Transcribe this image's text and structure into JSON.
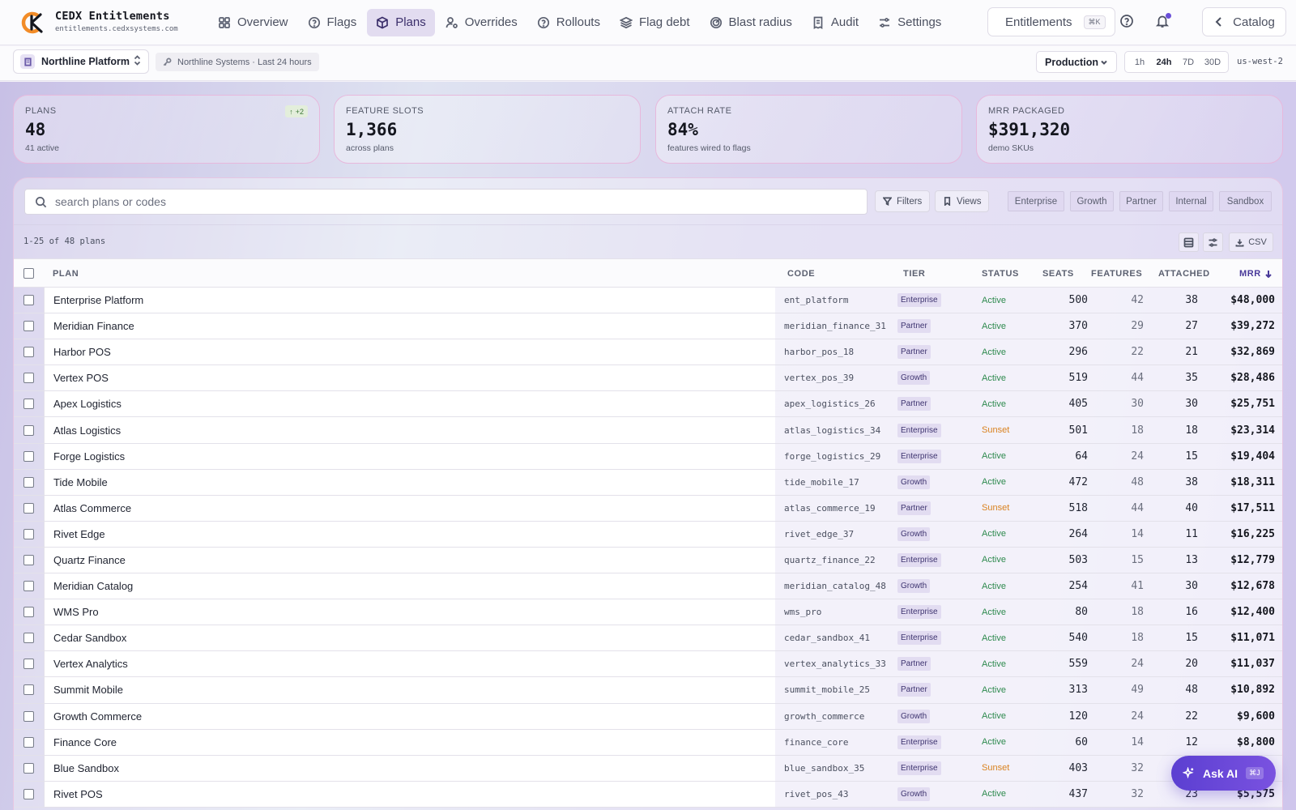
{
  "app": {
    "name": "CEDX Entitlements",
    "domain": "entitlements.cedxsystems.com"
  },
  "nav": {
    "tabs": [
      {
        "label": "Overview",
        "icon": "grid-icon"
      },
      {
        "label": "Flags",
        "icon": "help-circle-icon"
      },
      {
        "label": "Plans",
        "icon": "package-icon",
        "active": true
      },
      {
        "label": "Overrides",
        "icon": "user-cog-icon"
      },
      {
        "label": "Rollouts",
        "icon": "help-circle-icon"
      },
      {
        "label": "Flag debt",
        "icon": "layers-icon"
      },
      {
        "label": "Blast radius",
        "icon": "radar-icon"
      },
      {
        "label": "Audit",
        "icon": "receipt-icon"
      },
      {
        "label": "Settings",
        "icon": "sliders-icon"
      }
    ],
    "search_label": "Entitlements",
    "search_shortcut": "⌘K",
    "catalog_label": "Catalog"
  },
  "subbar": {
    "workspace": "Northline Platform",
    "context": "Northline Systems · Last 24 hours",
    "environment": "Production",
    "ranges": [
      "1h",
      "24h",
      "7D",
      "30D"
    ],
    "active_range": "24h",
    "region": "us-west-2"
  },
  "kpis": [
    {
      "label": "Plans",
      "value": "48",
      "sub": "41 active",
      "delta": "+2"
    },
    {
      "label": "Feature slots",
      "value": "1,366",
      "sub": "across plans"
    },
    {
      "label": "Attach rate",
      "value": "84%",
      "sub": "features wired to flags"
    },
    {
      "label": "MRR packaged",
      "value": "$391,320",
      "sub": "demo SKUs"
    }
  ],
  "toolbar": {
    "search_placeholder": "search plans or codes",
    "filters_label": "Filters",
    "views_label": "Views",
    "tier_chips": [
      "Enterprise",
      "Growth",
      "Partner",
      "Internal",
      "Sandbox"
    ],
    "count_text": "1-25 of 48 plans",
    "csv_label": "CSV"
  },
  "table": {
    "headers": {
      "plan": "Plan",
      "code": "Code",
      "tier": "Tier",
      "status": "Status",
      "seats": "Seats",
      "features": "Features",
      "attached": "Attached",
      "mrr": "MRR"
    },
    "rows": [
      {
        "plan": "Enterprise Platform",
        "code": "ent_platform",
        "tier": "Enterprise",
        "status": "Active",
        "seats": "500",
        "features": "42",
        "attached": "38",
        "mrr": "$48,000"
      },
      {
        "plan": "Meridian Finance",
        "code": "meridian_finance_31",
        "tier": "Partner",
        "status": "Active",
        "seats": "370",
        "features": "29",
        "attached": "27",
        "mrr": "$39,272"
      },
      {
        "plan": "Harbor POS",
        "code": "harbor_pos_18",
        "tier": "Partner",
        "status": "Active",
        "seats": "296",
        "features": "22",
        "attached": "21",
        "mrr": "$32,869"
      },
      {
        "plan": "Vertex POS",
        "code": "vertex_pos_39",
        "tier": "Growth",
        "status": "Active",
        "seats": "519",
        "features": "44",
        "attached": "35",
        "mrr": "$28,486"
      },
      {
        "plan": "Apex Logistics",
        "code": "apex_logistics_26",
        "tier": "Partner",
        "status": "Active",
        "seats": "405",
        "features": "30",
        "attached": "30",
        "mrr": "$25,751"
      },
      {
        "plan": "Atlas Logistics",
        "code": "atlas_logistics_34",
        "tier": "Enterprise",
        "status": "Sunset",
        "seats": "501",
        "features": "18",
        "attached": "18",
        "mrr": "$23,314"
      },
      {
        "plan": "Forge Logistics",
        "code": "forge_logistics_29",
        "tier": "Enterprise",
        "status": "Active",
        "seats": "64",
        "features": "24",
        "attached": "15",
        "mrr": "$19,404"
      },
      {
        "plan": "Tide Mobile",
        "code": "tide_mobile_17",
        "tier": "Growth",
        "status": "Active",
        "seats": "472",
        "features": "48",
        "attached": "38",
        "mrr": "$18,311"
      },
      {
        "plan": "Atlas Commerce",
        "code": "atlas_commerce_19",
        "tier": "Partner",
        "status": "Sunset",
        "seats": "518",
        "features": "44",
        "attached": "40",
        "mrr": "$17,511"
      },
      {
        "plan": "Rivet Edge",
        "code": "rivet_edge_37",
        "tier": "Growth",
        "status": "Active",
        "seats": "264",
        "features": "14",
        "attached": "11",
        "mrr": "$16,225"
      },
      {
        "plan": "Quartz Finance",
        "code": "quartz_finance_22",
        "tier": "Enterprise",
        "status": "Active",
        "seats": "503",
        "features": "15",
        "attached": "13",
        "mrr": "$12,779"
      },
      {
        "plan": "Meridian Catalog",
        "code": "meridian_catalog_48",
        "tier": "Growth",
        "status": "Active",
        "seats": "254",
        "features": "41",
        "attached": "30",
        "mrr": "$12,678"
      },
      {
        "plan": "WMS Pro",
        "code": "wms_pro",
        "tier": "Enterprise",
        "status": "Active",
        "seats": "80",
        "features": "18",
        "attached": "16",
        "mrr": "$12,400"
      },
      {
        "plan": "Cedar Sandbox",
        "code": "cedar_sandbox_41",
        "tier": "Enterprise",
        "status": "Active",
        "seats": "540",
        "features": "18",
        "attached": "15",
        "mrr": "$11,071"
      },
      {
        "plan": "Vertex Analytics",
        "code": "vertex_analytics_33",
        "tier": "Partner",
        "status": "Active",
        "seats": "559",
        "features": "24",
        "attached": "20",
        "mrr": "$11,037"
      },
      {
        "plan": "Summit Mobile",
        "code": "summit_mobile_25",
        "tier": "Partner",
        "status": "Active",
        "seats": "313",
        "features": "49",
        "attached": "48",
        "mrr": "$10,892"
      },
      {
        "plan": "Growth Commerce",
        "code": "growth_commerce",
        "tier": "Growth",
        "status": "Active",
        "seats": "120",
        "features": "24",
        "attached": "22",
        "mrr": "$9,600"
      },
      {
        "plan": "Finance Core",
        "code": "finance_core",
        "tier": "Enterprise",
        "status": "Active",
        "seats": "60",
        "features": "14",
        "attached": "12",
        "mrr": "$8,800"
      },
      {
        "plan": "Blue Sandbox",
        "code": "blue_sandbox_35",
        "tier": "Enterprise",
        "status": "Sunset",
        "seats": "403",
        "features": "32",
        "attached": "",
        "mrr": ""
      },
      {
        "plan": "Rivet POS",
        "code": "rivet_pos_43",
        "tier": "Growth",
        "status": "Active",
        "seats": "437",
        "features": "32",
        "attached": "23",
        "mrr": "$5,575"
      }
    ]
  },
  "status_colors": {
    "Active": "#2e8a4e",
    "Sunset": "#d9821f"
  },
  "ask_ai": {
    "label": "Ask AI",
    "shortcut": "⌘J"
  }
}
